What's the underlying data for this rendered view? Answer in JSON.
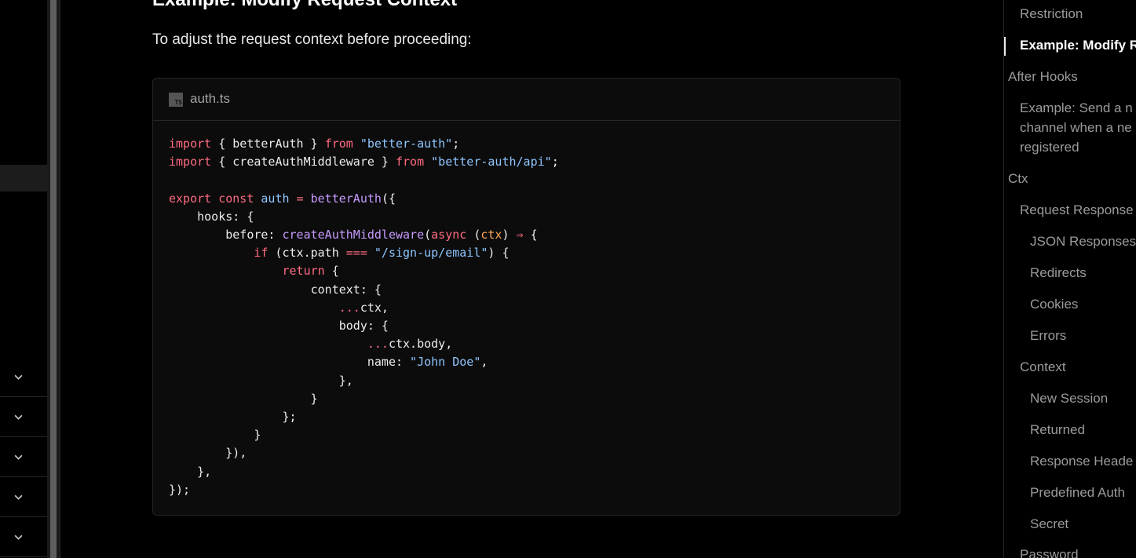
{
  "sidebar": {
    "chevron_icon": "chevron-down-icon"
  },
  "main": {
    "heading": "Example: Modify Request Context",
    "intro": "To adjust the request context before proceeding:",
    "code_block": {
      "language_icon": "TS",
      "filename": "auth.ts"
    }
  },
  "toc": {
    "items": [
      "Restriction",
      "Example: Modify R",
      "After Hooks",
      "Example: Send a n",
      "channel when a ne",
      "registered",
      "Ctx",
      "Request Response",
      "JSON Responses",
      "Redirects",
      "Cookies",
      "Errors",
      "Context",
      "New Session",
      "Returned",
      "Response Heade",
      "Predefined Auth",
      "Secret",
      "Password"
    ]
  },
  "colors": {
    "background": "#000000",
    "keyword": "#ff6b81",
    "string": "#8ec6ff",
    "function": "#c79bff",
    "param": "#ffa657"
  }
}
